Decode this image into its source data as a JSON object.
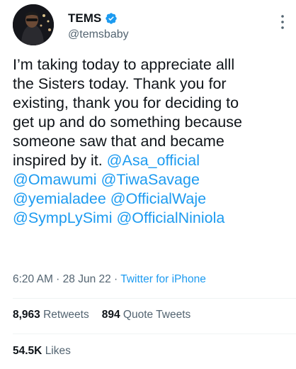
{
  "author": {
    "name": "TEMS",
    "handle": "@temsbaby"
  },
  "tweet": {
    "text_lines": [
      "I’m taking today to appreciate alll",
      "the Sisters today. Thank you for",
      "existing, thank you for deciding to",
      "get up and do something because",
      "someone saw that and became",
      "inspired by it. "
    ],
    "mentions": [
      "@Asa_official",
      "@Omawumi",
      "@TiwaSavage",
      "@yemialadee",
      "@OfficialWaje",
      "@SympLySimi",
      "@OfficialNiniola"
    ]
  },
  "meta": {
    "time": "6:20 AM",
    "date": "28 Jun 22",
    "separator": " · ",
    "source": "Twitter for iPhone"
  },
  "stats": {
    "retweets_count": "8,963",
    "retweets_label": "Retweets",
    "quote_count": "894",
    "quote_label": "Quote Tweets",
    "likes_count": "54.5K",
    "likes_label": "Likes"
  },
  "colors": {
    "accent": "#1d9bf0",
    "text": "#0f1419",
    "muted": "#536471"
  }
}
